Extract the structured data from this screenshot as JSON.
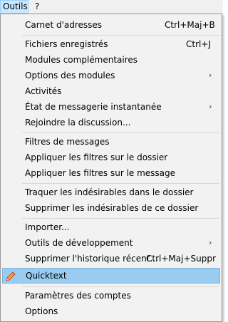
{
  "menubar": {
    "outils": "Outils",
    "help": "?"
  },
  "menu": {
    "items": [
      {
        "label": "Carnet d'adresses",
        "shortcut": "Ctrl+Maj+B"
      },
      {
        "label": "Fichiers enregistrés",
        "shortcut": "Ctrl+J"
      },
      {
        "label": "Modules complémentaires"
      },
      {
        "label": "Options des modules",
        "submenu": true
      },
      {
        "label": "Activités"
      },
      {
        "label": "État de messagerie instantanée",
        "submenu": true
      },
      {
        "label": "Rejoindre la discussion..."
      },
      {
        "label": "Filtres de messages"
      },
      {
        "label": "Appliquer les filtres sur le dossier"
      },
      {
        "label": "Appliquer les filtres sur le message"
      },
      {
        "label": "Traquer les indésirables dans le dossier"
      },
      {
        "label": "Supprimer les indésirables de ce dossier"
      },
      {
        "label": "Importer..."
      },
      {
        "label": "Outils de développement",
        "submenu": true
      },
      {
        "label": "Supprimer l'historique récent...",
        "shortcut": "Ctrl+Maj+Suppr"
      },
      {
        "label": "Quicktext",
        "icon": "quicktext-pencil-icon",
        "highlighted": true
      },
      {
        "label": "Paramètres des comptes"
      },
      {
        "label": "Options"
      }
    ],
    "submenu_arrow": "›"
  },
  "colors": {
    "menu_background": "#f2f2f2",
    "highlight": "#99ccf0",
    "menubar_active": "#cce8ff",
    "separator": "#d7d7d7"
  }
}
